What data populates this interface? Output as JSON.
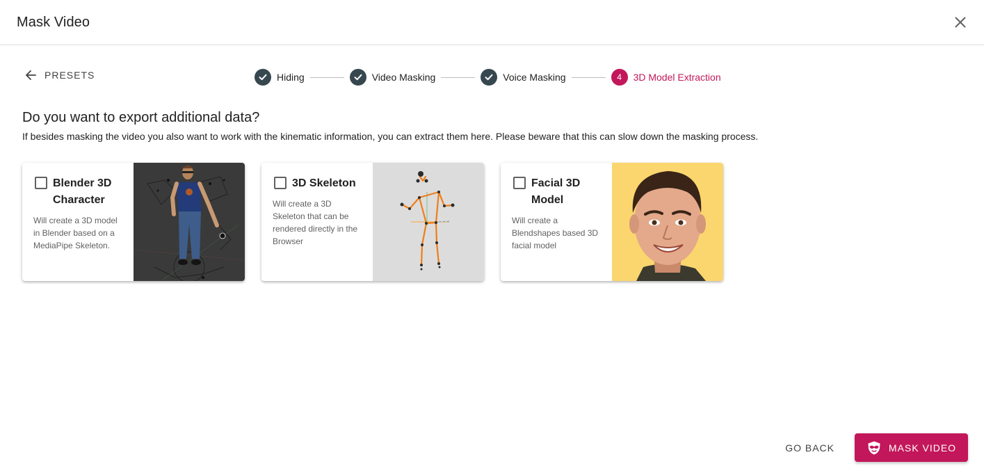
{
  "dialog": {
    "title": "Mask Video",
    "close_icon": "close-icon"
  },
  "nav": {
    "presets_label": "PRESETS",
    "back_icon": "arrow-left-icon"
  },
  "stepper": {
    "steps": [
      {
        "label": "Hiding",
        "state": "completed"
      },
      {
        "label": "Video Masking",
        "state": "completed"
      },
      {
        "label": "Voice Masking",
        "state": "completed"
      },
      {
        "label": "3D Model Extraction",
        "state": "active",
        "number": "4"
      }
    ]
  },
  "content": {
    "question": "Do you want to export additional data?",
    "description": "If besides masking the video you also want to work with the kinematic information, you can extract them here. Please beware that this can slow down the masking process."
  },
  "cards": [
    {
      "title": "Blender 3D Character",
      "text": "Will create a 3D model in Blender based on a MediaPipe Skeleton.",
      "checked": false
    },
    {
      "title": "3D Skeleton",
      "text": "Will create a 3D Skeleton that can be rendered directly in the Browser",
      "checked": false
    },
    {
      "title": "Facial 3D Model",
      "text": "Will create a Blendshapes based 3D facial model",
      "checked": false
    }
  ],
  "footer": {
    "go_back_label": "GO BACK",
    "mask_video_label": "MASK VIDEO",
    "mask_icon": "mask-icon"
  },
  "colors": {
    "accent": "#c2185b",
    "step_done": "#37474f"
  }
}
